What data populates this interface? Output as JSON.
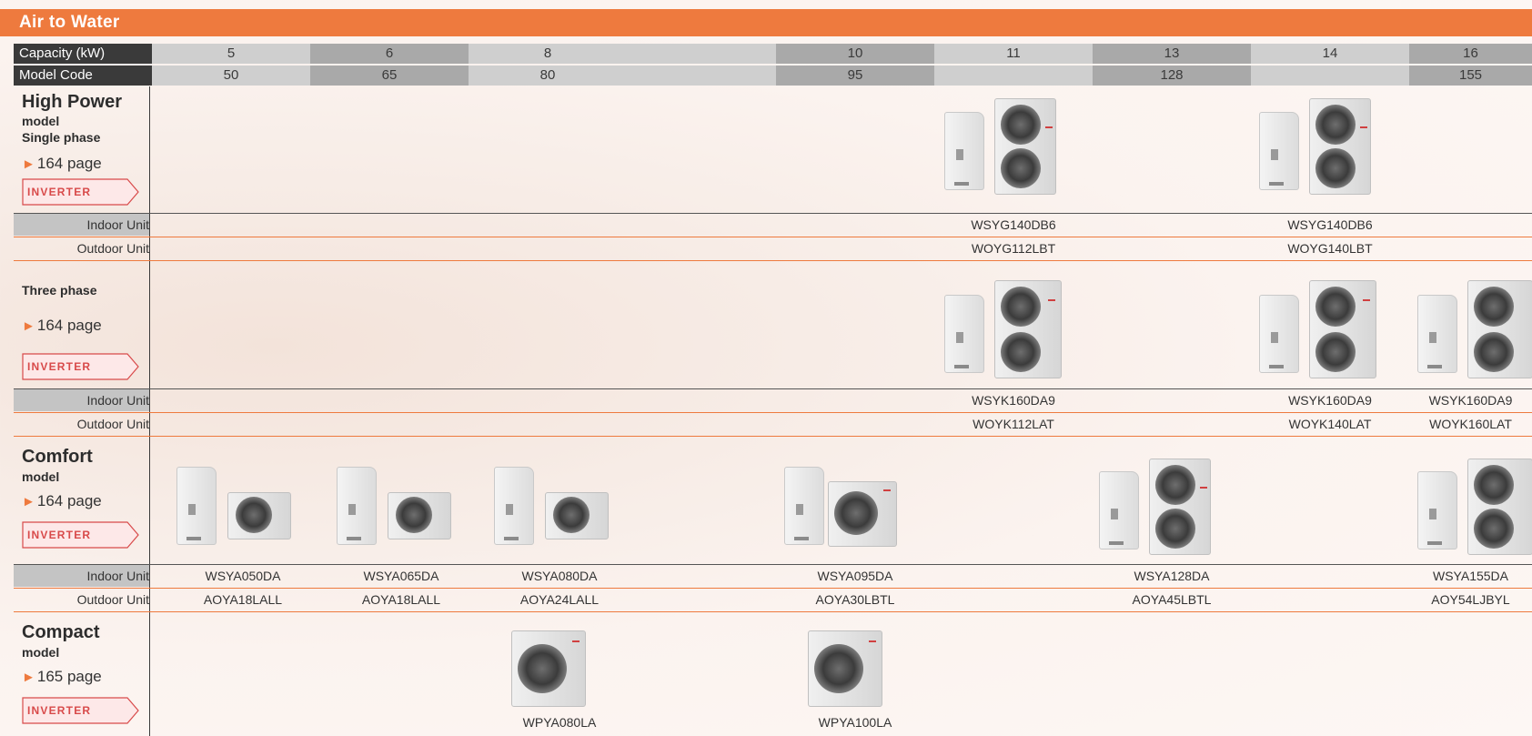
{
  "banner": {
    "title": "Air to Water"
  },
  "header": {
    "capacity_label": "Capacity (kW)",
    "model_label": "Model Code",
    "capacities": [
      "5",
      "6",
      "8",
      "",
      "10",
      "11",
      "13",
      "14",
      "16"
    ],
    "model_codes": [
      "50",
      "65",
      "80",
      "",
      "95",
      "",
      "128",
      "",
      "155"
    ]
  },
  "sections": {
    "high_power": {
      "title": "High Power",
      "sub1": "model",
      "sub2": "Single phase",
      "page": "164 page",
      "badge": "INVERTER"
    },
    "three_phase": {
      "sub": "Three phase",
      "page": "164 page",
      "badge": "INVERTER"
    },
    "comfort": {
      "title": "Comfort",
      "sub1": "model",
      "page": "164 page",
      "badge": "INVERTER"
    },
    "compact": {
      "title": "Compact",
      "sub1": "model",
      "page": "165 page",
      "badge": "INVERTER"
    }
  },
  "rows": {
    "indoor_label": "Indoor Unit",
    "outdoor_label": "Outdoor Unit",
    "hp_single": {
      "indoor": [
        "WSYG140DB6",
        "WSYG140DB6"
      ],
      "outdoor": [
        "WOYG112LBT",
        "WOYG140LBT"
      ]
    },
    "hp_three": {
      "indoor": [
        "WSYK160DA9",
        "WSYK160DA9",
        "WSYK160DA9"
      ],
      "outdoor": [
        "WOYK112LAT",
        "WOYK140LAT",
        "WOYK160LAT"
      ]
    },
    "comfort": {
      "indoor": [
        "WSYA050DA",
        "WSYA065DA",
        "WSYA080DA",
        "WSYA095DA",
        "WSYA128DA",
        "WSYA155DA"
      ],
      "outdoor": [
        "AOYA18LALL",
        "AOYA18LALL",
        "AOYA24LALL",
        "AOYA30LBTL",
        "AOYA45LBTL",
        "AOY54LJBYL"
      ]
    },
    "compact": {
      "units": [
        "WPYA080LA",
        "WPYA100LA"
      ]
    }
  },
  "icons": {
    "arrow": "triangle-right-icon",
    "inverter": "inverter-badge-icon",
    "product": "heat-pump-unit-icon"
  },
  "colors": {
    "accent": "#ee7a3e",
    "header_dark": "#3a3a3a"
  }
}
